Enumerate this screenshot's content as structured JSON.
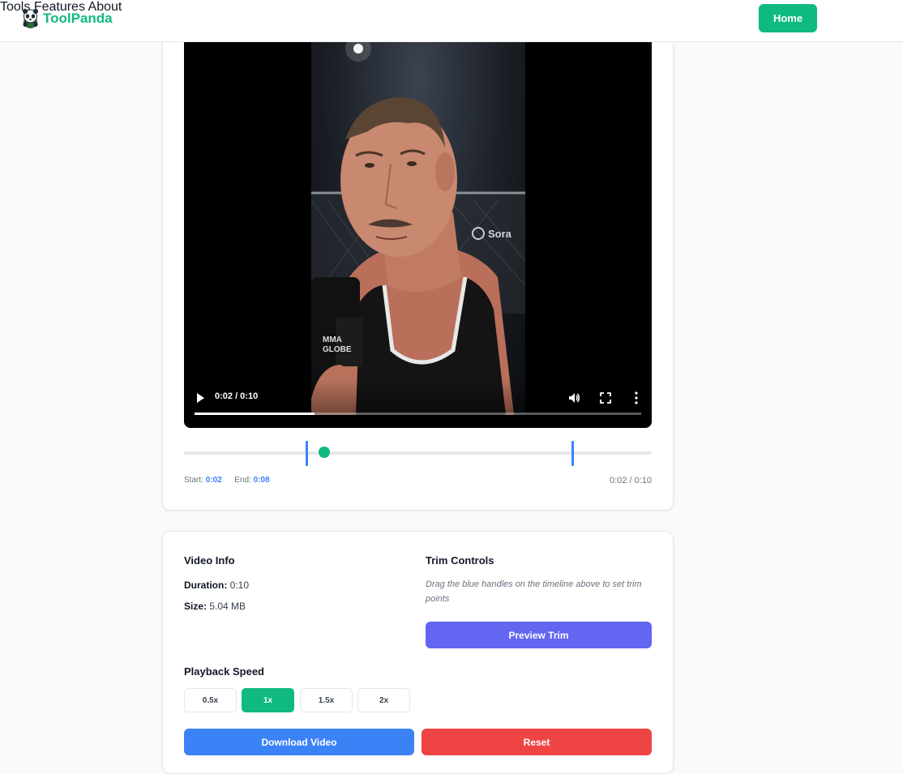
{
  "header": {
    "brand": "ToolPanda",
    "nav": [
      "Tools",
      "Features",
      "About"
    ],
    "home_label": "Home"
  },
  "video": {
    "current_time": "0:02 / 0:10",
    "watermark": "Sora",
    "progress_fraction": 0.2
  },
  "trim": {
    "start_label": "Start:",
    "start_value": "0:02",
    "end_label": "End:",
    "end_value": "0:08",
    "time_display": "0:02 / 0:10",
    "start_fraction": 0.2,
    "end_fraction": 0.8,
    "playhead_fraction": 0.3
  },
  "info": {
    "title": "Video Info",
    "duration_label": "Duration:",
    "duration_value": "0:10",
    "size_label": "Size:",
    "size_value": "5.04 MB"
  },
  "trim_controls": {
    "title": "Trim Controls",
    "hint": "Drag the blue handles on the timeline above to set trim points",
    "preview_label": "Preview Trim"
  },
  "playback": {
    "title": "Playback Speed",
    "options": [
      "0.5x",
      "1x",
      "1.5x",
      "2x"
    ],
    "selected": "1x"
  },
  "actions": {
    "download_label": "Download Video",
    "reset_label": "Reset"
  },
  "colors": {
    "brand": "#10b981",
    "handle": "#3b82f6",
    "preview": "#6366f1",
    "download": "#3b82f6",
    "reset": "#ef4444"
  },
  "icons": [
    "panda-logo-icon",
    "play-icon",
    "volume-icon",
    "fullscreen-icon",
    "more-options-icon"
  ]
}
